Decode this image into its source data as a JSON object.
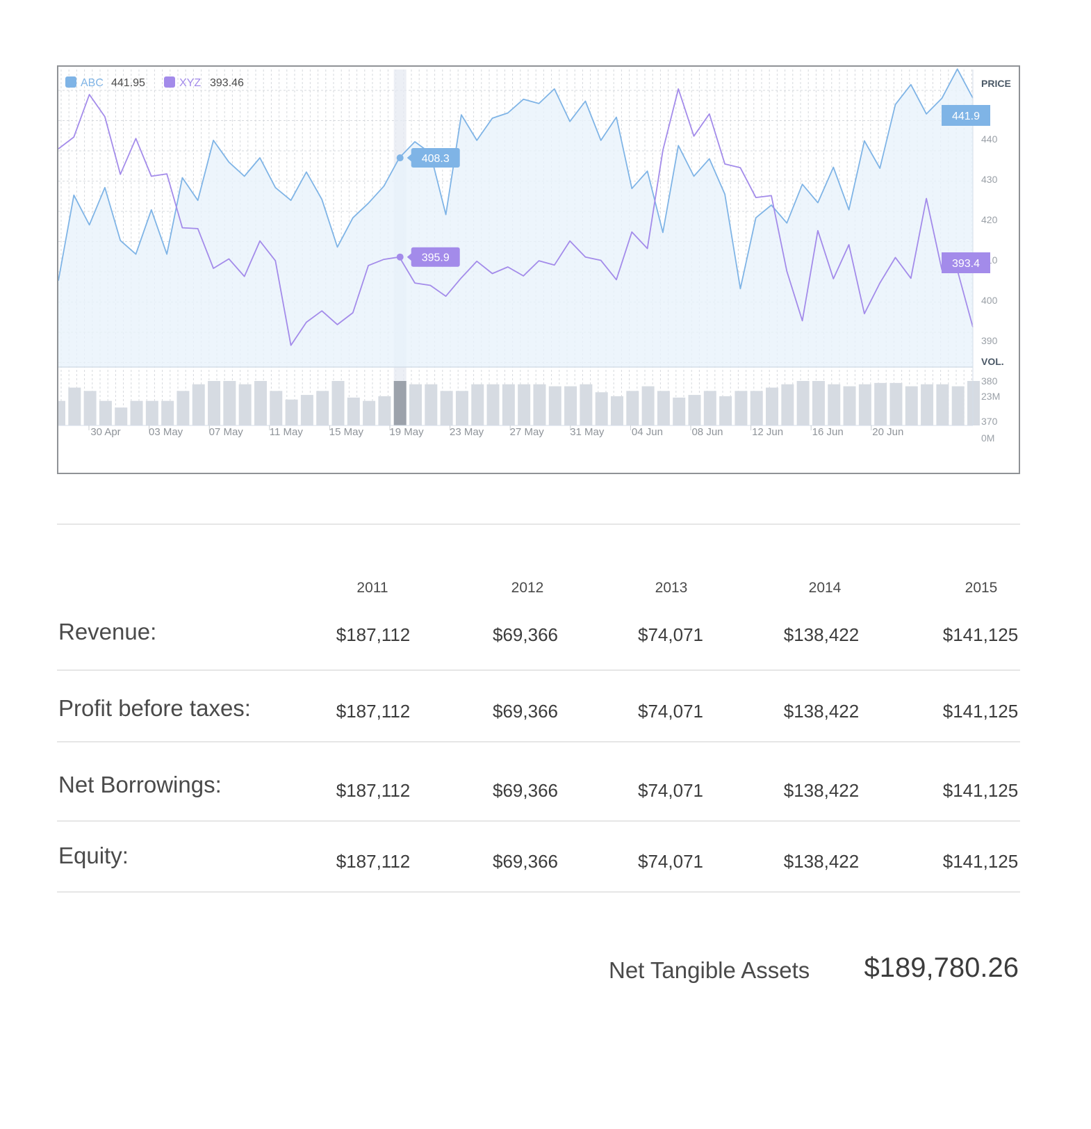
{
  "chart_data": {
    "type": "line",
    "series": [
      {
        "name": "ABC",
        "color": "#7fb4e6",
        "last_value": "441.95",
        "price_tag": "441.9",
        "values": [
          403.3,
          421.4,
          415.1,
          423.0,
          411.8,
          408.9,
          418.3,
          408.9,
          425.1,
          420.3,
          433.0,
          428.4,
          425.4,
          429.3,
          423.0,
          420.3,
          426.3,
          420.5,
          410.4,
          416.6,
          419.7,
          423.3,
          429.3,
          432.7,
          430.3,
          417.3,
          438.4,
          433.0,
          437.7,
          438.8,
          441.7,
          440.8,
          443.9,
          437.0,
          441.3,
          433.0,
          437.9,
          422.8,
          426.5,
          413.5,
          431.9,
          425.4,
          429.1,
          421.6,
          401.6,
          416.6,
          419.3,
          415.5,
          423.7,
          419.8,
          427.3,
          418.3,
          432.9,
          427.1,
          440.6,
          444.8,
          438.6,
          441.9,
          448.1,
          441.95
        ]
      },
      {
        "name": "XYZ",
        "color": "#a38bea",
        "last_value": "393.46",
        "price_tag": "393.4",
        "values": [
          431.2,
          433.7,
          442.7,
          438.0,
          425.8,
          433.4,
          425.4,
          425.9,
          414.5,
          414.3,
          405.9,
          407.9,
          404.2,
          411.7,
          407.5,
          389.6,
          394.5,
          396.9,
          394.0,
          396.5,
          406.5,
          407.8,
          408.3,
          402.8,
          402.3,
          400.0,
          403.9,
          407.4,
          404.8,
          406.2,
          404.3,
          407.5,
          406.6,
          411.7,
          408.3,
          407.6,
          403.5,
          413.6,
          410.1,
          430.9,
          443.9,
          433.9,
          438.6,
          428.0,
          427.2,
          420.9,
          421.3,
          405.3,
          394.8,
          413.9,
          403.7,
          410.9,
          396.3,
          402.8,
          408.2,
          403.8,
          420.7,
          405.6,
          405.5,
          393.46
        ]
      }
    ],
    "legend": "top-left",
    "ylabel": "PRICE",
    "volume_label": "VOL.",
    "ylim": [
      385,
      448
    ],
    "price_ticks": [
      440,
      430,
      420,
      410,
      400,
      390,
      380,
      370
    ],
    "volume_ticks": [
      "23M",
      "0M"
    ],
    "date_labels": [
      "30 Apr",
      "03 May",
      "07 May",
      "11 May",
      "15 May",
      "19 May",
      "23 May",
      "27 May",
      "31 May",
      "04 Jun",
      "08 Jun",
      "12 Jun",
      "16 Jun",
      "20 Jun"
    ],
    "volume": [
      37,
      57,
      52,
      37,
      27,
      37,
      37,
      37,
      52,
      62,
      67,
      67,
      62,
      67,
      52,
      39,
      46,
      52,
      67,
      42,
      37,
      44,
      67,
      62,
      62,
      52,
      52,
      62,
      62,
      62,
      62,
      62,
      59,
      59,
      62,
      50,
      44,
      52,
      59,
      52,
      42,
      46,
      52,
      44,
      52,
      52,
      57,
      62,
      67,
      67,
      62,
      59,
      62,
      64,
      64,
      59,
      62,
      62,
      59,
      67
    ],
    "selected_index": 22,
    "tooltips": [
      {
        "series": "ABC",
        "value": "408.3"
      },
      {
        "series": "XYZ",
        "value": "395.9"
      }
    ],
    "grid": true
  },
  "table": {
    "years": [
      "2011",
      "2012",
      "2013",
      "2014",
      "2015"
    ],
    "rows": [
      {
        "label": "Revenue:",
        "values": [
          "$187,112",
          "$69,366",
          "$74,071",
          "$138,422",
          "$141,125"
        ]
      },
      {
        "label": "Profit before taxes:",
        "values": [
          "$187,112",
          "$69,366",
          "$74,071",
          "$138,422",
          "$141,125"
        ]
      },
      {
        "label": "Net Borrowings:",
        "values": [
          "$187,112",
          "$69,366",
          "$74,071",
          "$138,422",
          "$141,125"
        ]
      },
      {
        "label": "Equity:",
        "values": [
          "$187,112",
          "$69,366",
          "$74,071",
          "$138,422",
          "$141,125"
        ]
      }
    ]
  },
  "summary": {
    "label": "Net Tangible Assets",
    "value": "$189,780.26"
  }
}
